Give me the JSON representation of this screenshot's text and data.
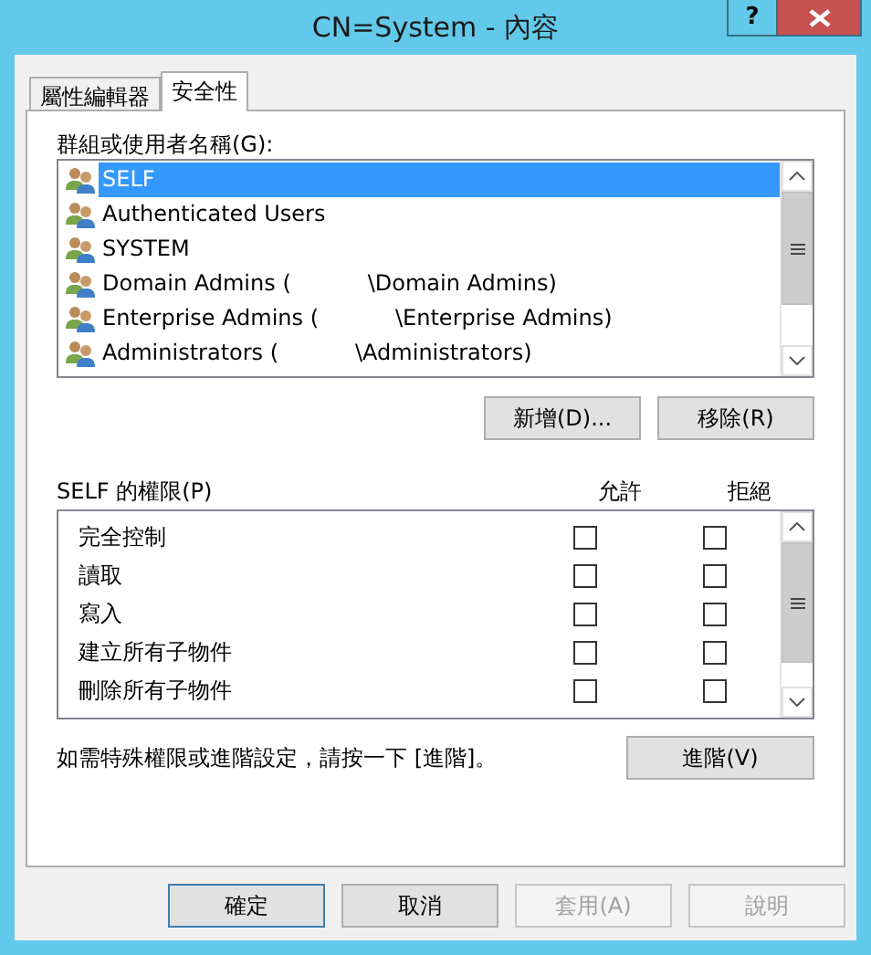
{
  "window": {
    "title": "CN=System - 內容",
    "help_button": "?"
  },
  "tabs": [
    {
      "label": "屬性編輯器",
      "selected": false
    },
    {
      "label": "安全性",
      "selected": true
    }
  ],
  "groups": {
    "label": "群組或使用者名稱(G):",
    "items": [
      {
        "name": "SELF",
        "selected": true
      },
      {
        "name": "Authenticated Users",
        "selected": false
      },
      {
        "name": "SYSTEM",
        "selected": false
      },
      {
        "name": "Domain Admins (           \\Domain Admins)",
        "selected": false
      },
      {
        "name": "Enterprise Admins (           \\Enterprise Admins)",
        "selected": false
      },
      {
        "name": "Administrators (           \\Administrators)",
        "selected": false
      }
    ]
  },
  "group_buttons": [
    "新增(D)...",
    "移除(R)"
  ],
  "permissions": {
    "label": "SELF 的權限(P)",
    "allow_header": "允許",
    "deny_header": "拒絕",
    "rows": [
      {
        "name": "完全控制",
        "allow": false,
        "deny": false
      },
      {
        "name": "讀取",
        "allow": false,
        "deny": false
      },
      {
        "name": "寫入",
        "allow": false,
        "deny": false
      },
      {
        "name": "建立所有子物件",
        "allow": false,
        "deny": false
      },
      {
        "name": "刪除所有子物件",
        "allow": false,
        "deny": false
      }
    ]
  },
  "advanced": {
    "hint": "如需特殊權限或進階設定，請按一下 [進階]。",
    "button": "進階(V)"
  },
  "buttons": [
    {
      "label": "確定",
      "default": true,
      "disabled": false
    },
    {
      "label": "取消",
      "default": false,
      "disabled": false
    },
    {
      "label": "套用(A)",
      "default": false,
      "disabled": true
    },
    {
      "label": "說明",
      "default": false,
      "disabled": true
    }
  ]
}
